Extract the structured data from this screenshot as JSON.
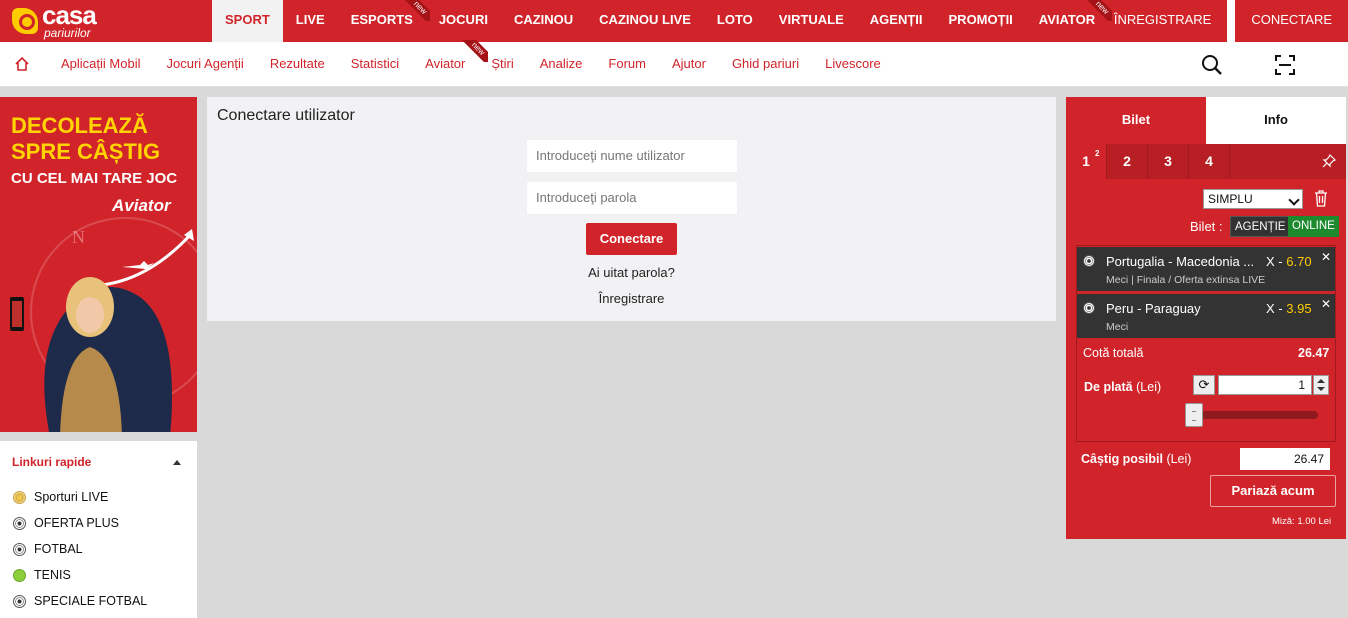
{
  "brand": {
    "name": "casa",
    "sub": "pariurilor"
  },
  "topnav": {
    "items": [
      {
        "label": "SPORT",
        "active": true,
        "isNew": false
      },
      {
        "label": "LIVE",
        "active": false,
        "isNew": false
      },
      {
        "label": "ESPORTS",
        "active": false,
        "isNew": true
      },
      {
        "label": "JOCURI",
        "active": false,
        "isNew": false
      },
      {
        "label": "CAZINOU",
        "active": false,
        "isNew": false
      },
      {
        "label": "CAZINOU LIVE",
        "active": false,
        "isNew": false
      },
      {
        "label": "LOTO",
        "active": false,
        "isNew": false
      },
      {
        "label": "VIRTUALE",
        "active": false,
        "isNew": false
      },
      {
        "label": "AGENȚII",
        "active": false,
        "isNew": false
      },
      {
        "label": "PROMOȚII",
        "active": false,
        "isNew": false
      },
      {
        "label": "AVIATOR",
        "active": false,
        "isNew": true
      }
    ],
    "new_badge": "new",
    "register": "ÎNREGISTRARE",
    "login": "CONECTARE"
  },
  "subnav": {
    "items": [
      {
        "label": "Aplicații Mobil",
        "isNew": false
      },
      {
        "label": "Jocuri Agenții",
        "isNew": false
      },
      {
        "label": "Rezultate",
        "isNew": false
      },
      {
        "label": "Statistici",
        "isNew": false
      },
      {
        "label": "Aviator",
        "isNew": true
      },
      {
        "label": "Știri",
        "isNew": false
      },
      {
        "label": "Analize",
        "isNew": false
      },
      {
        "label": "Forum",
        "isNew": false
      },
      {
        "label": "Ajutor",
        "isNew": false
      },
      {
        "label": "Ghid pariuri",
        "isNew": false
      },
      {
        "label": "Livescore",
        "isNew": false
      }
    ]
  },
  "banner": {
    "line1": "DECOLEAZĂ",
    "line2": "SPRE CÂȘTIG",
    "line3": "CU CEL MAI TARE JOC",
    "brand": "Aviator"
  },
  "quick_links": {
    "title": "Linkuri rapide",
    "items": [
      {
        "label": "Sporturi LIVE",
        "icon": "star"
      },
      {
        "label": "OFERTA PLUS",
        "icon": "soccer"
      },
      {
        "label": "FOTBAL",
        "icon": "soccer"
      },
      {
        "label": "TENIS",
        "icon": "tennis"
      },
      {
        "label": "SPECIALE FOTBAL",
        "icon": "soccer"
      }
    ]
  },
  "login": {
    "title": "Conectare utilizator",
    "username_placeholder": "Introduceţi nume utilizator",
    "password_placeholder": "Introduceţi parola",
    "button": "Conectare",
    "forgot": "Ai uitat parola?",
    "register": "Înregistrare"
  },
  "betslip": {
    "tab_bilet": "Bilet",
    "tab_info": "Info",
    "slips": [
      "1",
      "2",
      "3",
      "4"
    ],
    "active_slip_count": "2",
    "bet_type": "SIMPLU",
    "bilet_label": "Bilet :",
    "agentie": "AGENȚIE",
    "online": "ONLINE",
    "bets": [
      {
        "name": "Portugalia - Macedonia ...",
        "pick": "X -",
        "odd": "6.70",
        "sub": "Meci | Finala / Oferta extinsa LIVE"
      },
      {
        "name": "Peru - Paraguay",
        "pick": "X -",
        "odd": "3.95",
        "sub": "Meci"
      }
    ],
    "total_label": "Cotă totală",
    "total_value": "26.47",
    "stake_label": "De plată",
    "currency_label": "(Lei)",
    "stake_value": "1",
    "win_label": "Câștig posibil",
    "win_value": "26.47",
    "place_button": "Pariază acum",
    "min_bet": "Miză: 1.00 Lei"
  }
}
